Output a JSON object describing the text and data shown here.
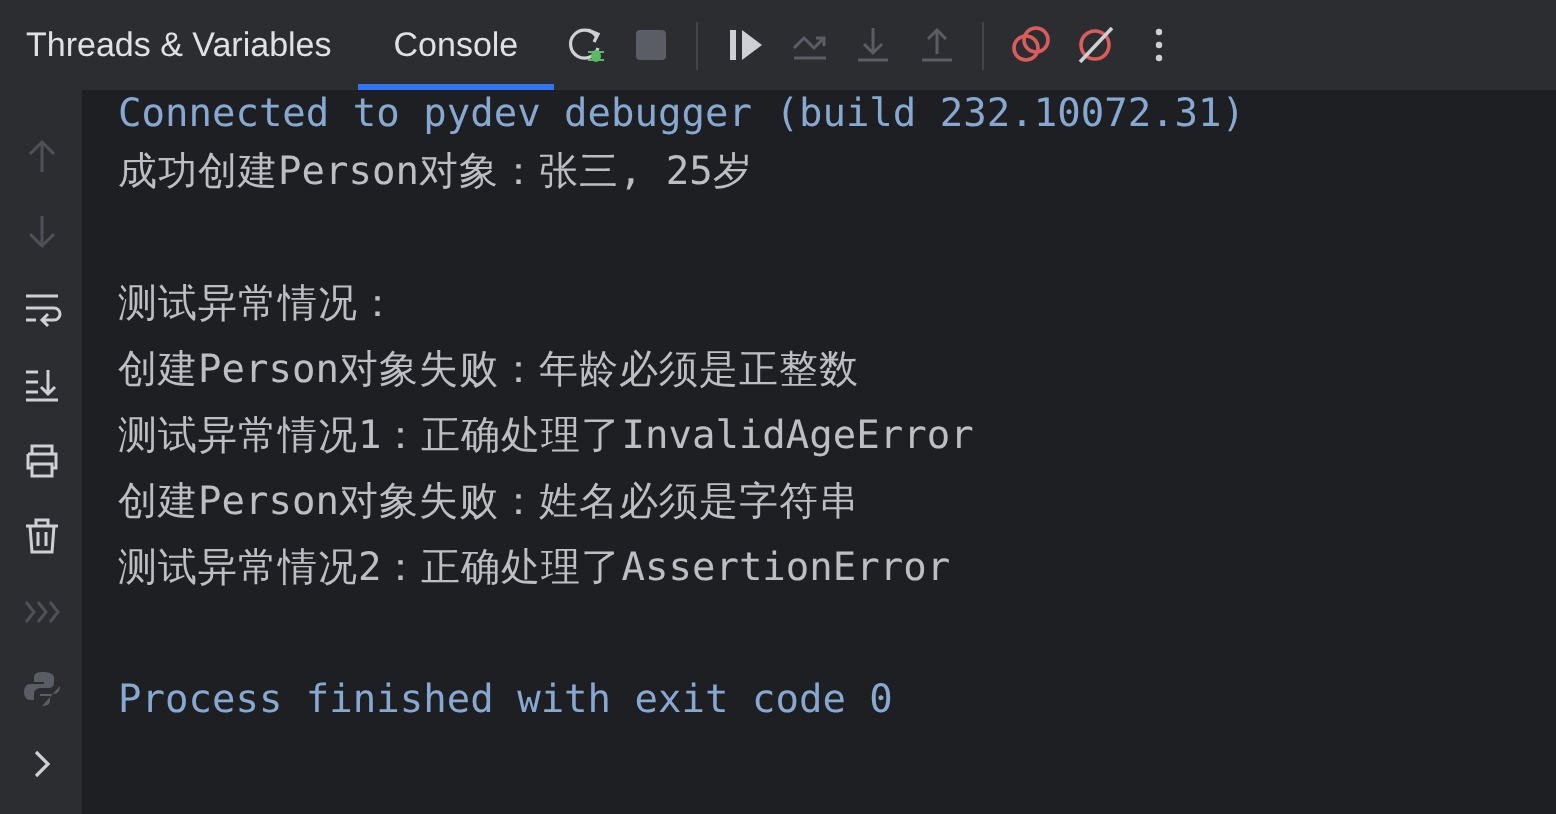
{
  "tabs": [
    {
      "label": "Threads & Variables",
      "selected": false
    },
    {
      "label": "Console",
      "selected": true
    }
  ],
  "toolbar": [
    {
      "kind": "rerun",
      "disabled": false
    },
    {
      "kind": "stop",
      "disabled": true
    },
    {
      "kind": "separator"
    },
    {
      "kind": "resume",
      "disabled": false
    },
    {
      "kind": "step-over",
      "disabled": true
    },
    {
      "kind": "step-into",
      "disabled": true
    },
    {
      "kind": "step-out",
      "disabled": true
    },
    {
      "kind": "separator"
    },
    {
      "kind": "breakpoints",
      "disabled": false
    },
    {
      "kind": "mute",
      "disabled": false
    },
    {
      "kind": "more",
      "disabled": false
    }
  ],
  "console": {
    "lines": [
      {
        "kind": "system",
        "text": "Connected to pydev debugger (build 232.10072.31)"
      },
      {
        "kind": "output",
        "text": "成功创建Person对象：张三, 25岁"
      },
      {
        "kind": "blank"
      },
      {
        "kind": "output",
        "text": "测试异常情况："
      },
      {
        "kind": "output",
        "text": "创建Person对象失败：年龄必须是正整数"
      },
      {
        "kind": "output",
        "text": "测试异常情况1：正确处理了InvalidAgeError"
      },
      {
        "kind": "output",
        "text": "创建Person对象失败：姓名必须是字符串"
      },
      {
        "kind": "output",
        "text": "测试异常情况2：正确处理了AssertionError"
      },
      {
        "kind": "blank"
      },
      {
        "kind": "system",
        "text": "Process finished with exit code 0"
      }
    ]
  }
}
